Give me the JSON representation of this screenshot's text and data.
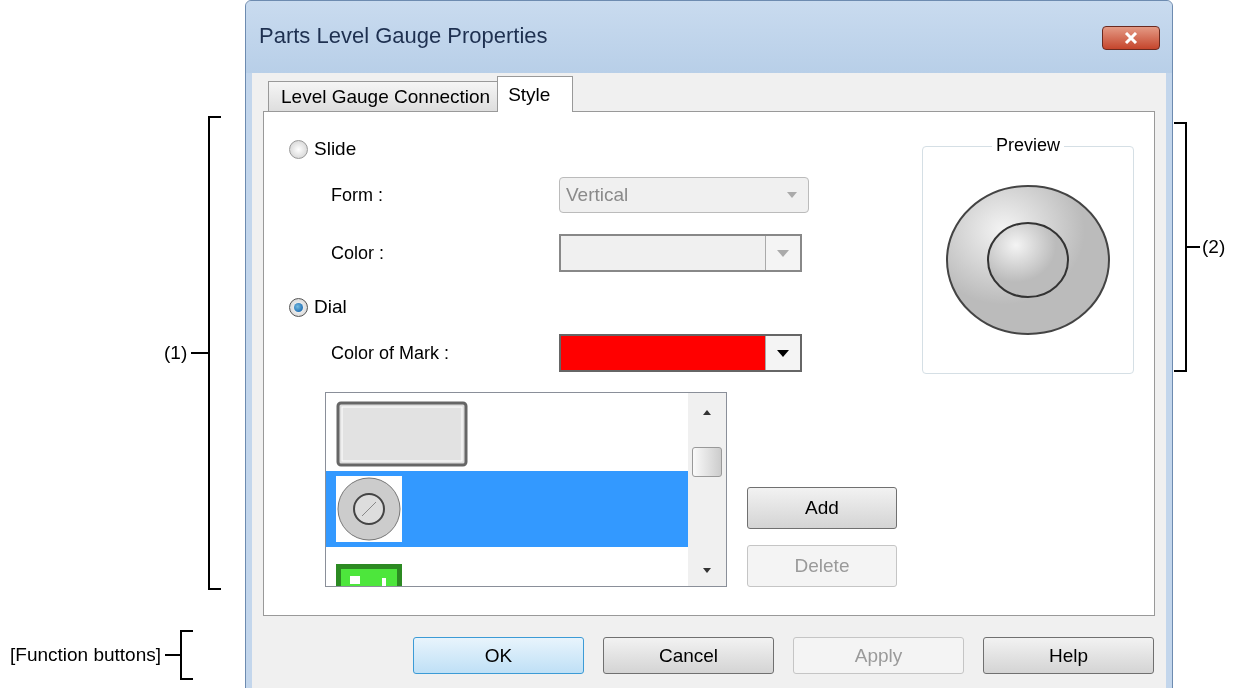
{
  "window": {
    "title": "Parts Level Gauge Properties"
  },
  "tabs": [
    {
      "label": "Level Gauge Connection",
      "selected": false
    },
    {
      "label": "Style",
      "selected": true
    }
  ],
  "style_options": [
    {
      "label": "Slide",
      "selected": false,
      "fields": [
        {
          "label": "Form :",
          "kind": "text",
          "value": "Vertical",
          "disabled": true
        },
        {
          "label": "Color :",
          "kind": "color",
          "disabled": true
        }
      ]
    },
    {
      "label": "Dial",
      "selected": true,
      "fields": [
        {
          "label": "Color of Mark :",
          "kind": "color",
          "color": "#ff0000",
          "disabled": false
        }
      ]
    }
  ],
  "image_list": {
    "items": [
      {
        "kind": "panel",
        "selected": false
      },
      {
        "kind": "dial",
        "selected": true
      },
      {
        "kind": "lamp",
        "selected": false
      }
    ]
  },
  "list_buttons": [
    {
      "label": "Add",
      "disabled": false
    },
    {
      "label": "Delete",
      "disabled": true
    }
  ],
  "preview": {
    "title": "Preview"
  },
  "function_buttons": [
    {
      "label": "OK",
      "disabled": false,
      "default": true
    },
    {
      "label": "Cancel",
      "disabled": false,
      "default": false
    },
    {
      "label": "Apply",
      "disabled": true,
      "default": false
    },
    {
      "label": "Help",
      "disabled": false,
      "default": false
    }
  ],
  "annotations": [
    {
      "label": "(1)"
    },
    {
      "label": "(2)"
    },
    {
      "label": "[Function buttons]"
    }
  ]
}
